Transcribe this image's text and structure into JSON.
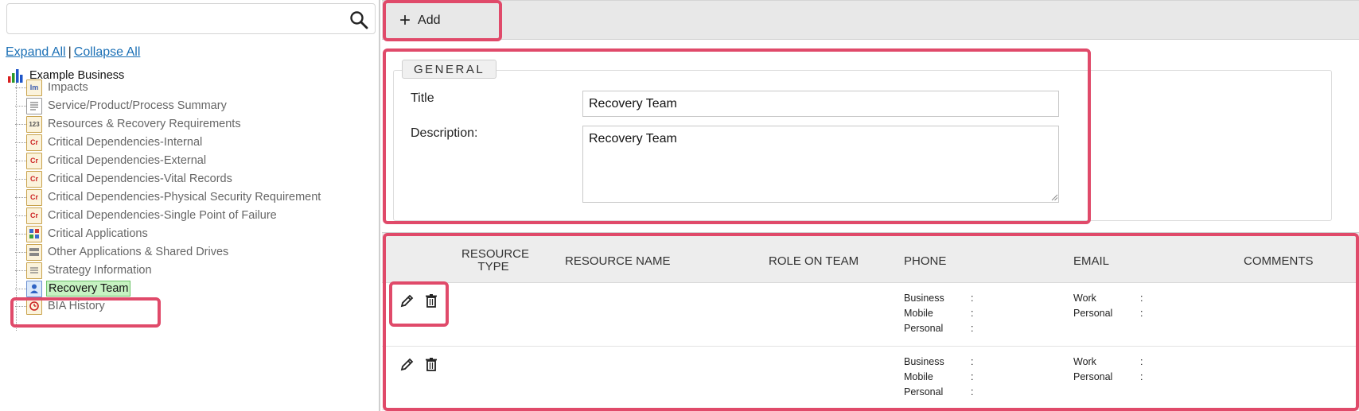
{
  "search": {
    "placeholder": "",
    "icon": "search-icon"
  },
  "tree_actions": {
    "expand_all": "Expand All",
    "separator": "|",
    "collapse_all": "Collapse All"
  },
  "tree": {
    "root": {
      "label": "Example Business",
      "icon": "bar-chart-icon"
    },
    "items": [
      {
        "label": "Impacts",
        "icon_text": "Im"
      },
      {
        "label": "Service/Product/Process Summary",
        "icon_text": ""
      },
      {
        "label": "Resources & Recovery Requirements",
        "icon_text": "123"
      },
      {
        "label": "Critical Dependencies-Internal",
        "icon_text": "Cr"
      },
      {
        "label": "Critical Dependencies-External",
        "icon_text": "Cr"
      },
      {
        "label": "Critical Dependencies-Vital Records",
        "icon_text": "Cr"
      },
      {
        "label": "Critical Dependencies-Physical Security Requirement",
        "icon_text": "Cr"
      },
      {
        "label": "Critical Dependencies-Single Point of Failure",
        "icon_text": "Cr"
      },
      {
        "label": "Critical Applications",
        "icon_text": ""
      },
      {
        "label": "Other Applications & Shared Drives",
        "icon_text": ""
      },
      {
        "label": "Strategy Information",
        "icon_text": ""
      },
      {
        "label": "Recovery Team",
        "icon_text": "",
        "selected": true
      },
      {
        "label": "BIA History",
        "icon_text": ""
      }
    ]
  },
  "toolbar": {
    "add_label": "Add"
  },
  "general": {
    "legend": "GENERAL",
    "title_label": "Title",
    "title_value": "Recovery Team",
    "description_label": "Description:",
    "description_value": "Recovery Team"
  },
  "grid": {
    "columns": {
      "resource_type": "RESOURCE TYPE",
      "resource_name": "RESOURCE NAME",
      "role_on_team": "ROLE ON TEAM",
      "phone": "PHONE",
      "email": "EMAIL",
      "comments": "COMMENTS"
    },
    "rows": [
      {
        "phone": [
          {
            "k": "Business",
            "c": ":"
          },
          {
            "k": "Mobile",
            "c": ":"
          },
          {
            "k": "Personal",
            "c": ":"
          }
        ],
        "email": [
          {
            "k": "Work",
            "c": ":"
          },
          {
            "k": "Personal",
            "c": ":"
          }
        ]
      },
      {
        "phone": [
          {
            "k": "Business",
            "c": ":"
          },
          {
            "k": "Mobile",
            "c": ":"
          },
          {
            "k": "Personal",
            "c": ":"
          }
        ],
        "email": [
          {
            "k": "Work",
            "c": ":"
          },
          {
            "k": "Personal",
            "c": ":"
          }
        ]
      }
    ]
  },
  "colors": {
    "highlight": "#e04a6a",
    "link": "#1a6fb5",
    "selected_bg": "#c6f2c2"
  }
}
